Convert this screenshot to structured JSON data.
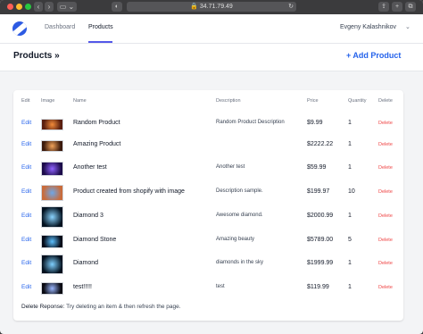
{
  "browser": {
    "address": "34.71.79.49"
  },
  "app": {
    "nav": [
      "Dashboard",
      "Products"
    ],
    "active_nav": "Products",
    "user": "Evgeny Kalashnikov"
  },
  "page": {
    "title": "Products »",
    "add_button": "+ Add Product"
  },
  "table": {
    "headers": {
      "edit": "Edit",
      "image": "Image",
      "name": "Name",
      "description": "Description",
      "price": "Price",
      "quantity": "Quantity",
      "delete": "Delete"
    },
    "rows": [
      {
        "edit": "Edit",
        "name": "Random Product",
        "description": "Random Product Description",
        "price": "$9.99",
        "quantity": "1",
        "delete": "Delete",
        "thumb": [
          "#f28b3a",
          "#5a1f0f"
        ]
      },
      {
        "edit": "Edit",
        "name": "Amazing Product",
        "description": "",
        "price": "$2222.22",
        "quantity": "1",
        "delete": "Delete",
        "thumb": [
          "#f2a35a",
          "#3b1a0c"
        ]
      },
      {
        "edit": "Edit",
        "name": "Another test",
        "description": "Another test",
        "price": "$59.99",
        "quantity": "1",
        "delete": "Delete",
        "thumb": [
          "#8f63ff",
          "#1c0b4a"
        ]
      },
      {
        "edit": "Edit",
        "name": "Product created from shopify with image",
        "description": "Description sample.",
        "price": "$199.97",
        "quantity": "10",
        "delete": "Delete",
        "thumb": [
          "#6da7e8",
          "#c96b3a"
        ]
      },
      {
        "edit": "Edit",
        "name": "Diamond 3",
        "description": "Awesome diamond.",
        "price": "$2000.99",
        "quantity": "1",
        "delete": "Delete",
        "thumb": [
          "#8ad4ff",
          "#02111f"
        ]
      },
      {
        "edit": "Edit",
        "name": "Diamond Stone",
        "description": "Amazing beauty",
        "price": "$5789.00",
        "quantity": "5",
        "delete": "Delete",
        "thumb": [
          "#5cc0ff",
          "#050b18"
        ]
      },
      {
        "edit": "Edit",
        "name": "Diamond",
        "description": "diamonds in the sky",
        "price": "$1999.99",
        "quantity": "1",
        "delete": "Delete",
        "thumb": [
          "#7fd0ff",
          "#03101d"
        ]
      },
      {
        "edit": "Edit",
        "name": "test!!!!!",
        "description": "test",
        "price": "$119.99",
        "quantity": "1",
        "delete": "Delete",
        "thumb": [
          "#9ab7ff",
          "#0a0a12"
        ]
      }
    ]
  },
  "footer": {
    "label": "Delete Reponse:",
    "text": "Try deleting an item & then refresh the page."
  },
  "colors": {
    "link": "#2563eb",
    "danger": "#ef4444",
    "accent": "#5458e8"
  }
}
